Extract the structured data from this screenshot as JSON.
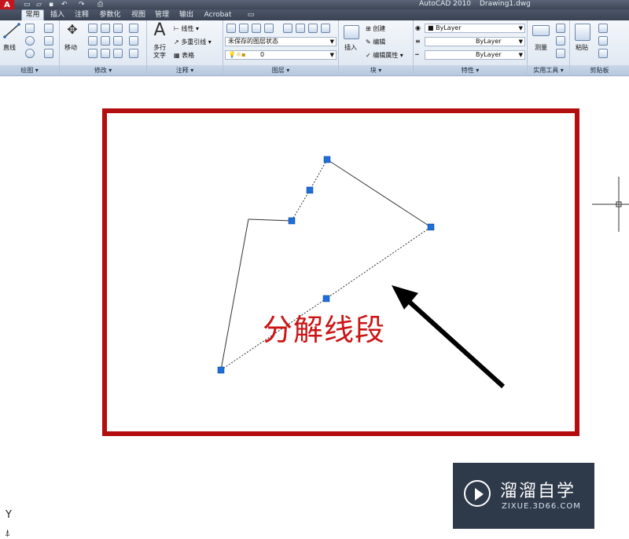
{
  "app": {
    "logo": "A",
    "title": "AutoCAD 2010",
    "document": "Drawing1.dwg"
  },
  "quick_access": [
    "undo-icon",
    "redo-icon",
    "print-icon"
  ],
  "tabs": [
    "常用",
    "插入",
    "注释",
    "参数化",
    "视图",
    "管理",
    "输出",
    "Acrobat"
  ],
  "ribbon": {
    "draw": {
      "title": "绘图",
      "line_label": "直线"
    },
    "modify": {
      "title": "修改",
      "move_label": "移动"
    },
    "annotation": {
      "title": "注释",
      "mtext_label": "多行文字",
      "linear_label": "线性",
      "multileader_label": "多重引线",
      "table_label": "表格",
      "big_glyph": "A"
    },
    "layers": {
      "title": "图层",
      "state_value": "未保存的图层状态",
      "current_layer": "0"
    },
    "block": {
      "title": "块",
      "insert_label": "插入",
      "create_label": "创建",
      "edit_label": "编辑",
      "edit_attr_label": "编辑属性"
    },
    "properties": {
      "title": "特性",
      "color_value": "ByLayer",
      "linetype_value": "ByLayer",
      "lineweight_value": "ByLayer"
    },
    "utilities": {
      "title": "实用工具",
      "measure_label": "测量"
    },
    "clipboard": {
      "title": "剪贴板",
      "paste_label": "粘贴"
    }
  },
  "canvas": {
    "caption": "分解线段",
    "ucs_y_label": "Y"
  },
  "watermark": {
    "name": "溜溜自学",
    "url": "ZIXUE.3D66.COM"
  },
  "colors": {
    "frame": "#b30d0d",
    "grip": "#1e6fd9",
    "caption": "#cc1515"
  }
}
